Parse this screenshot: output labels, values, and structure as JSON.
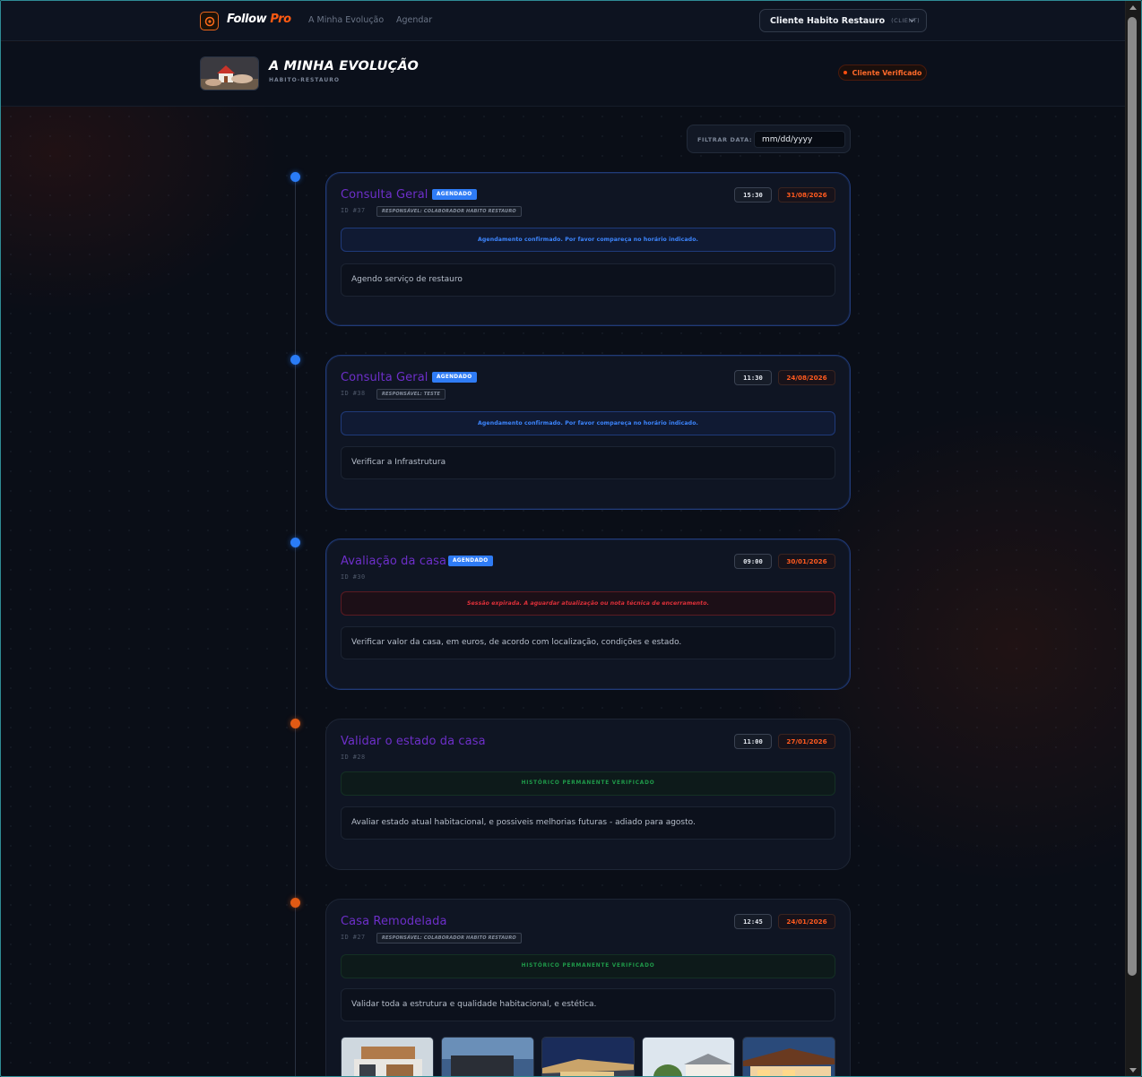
{
  "brand": {
    "name_white": "Follow",
    "name_orange": "Pro"
  },
  "nav": {
    "items": [
      {
        "label": "A Minha Evolução"
      },
      {
        "label": "Agendar"
      }
    ]
  },
  "client": {
    "name": "Cliente Habito Restauro",
    "role": "(CLIENT)"
  },
  "header": {
    "title": "A MINHA EVOLUÇÃO",
    "subtitle": "HABITO-RESTAURO",
    "verified_label": "Cliente Verificado"
  },
  "filter": {
    "label": "FILTRAR DATA:",
    "placeholder": "mm/dd/yyyy"
  },
  "colors": {
    "accent_orange": "#ff5a12",
    "accent_blue": "#2f7cf6",
    "title_purple": "#6d2fc9",
    "status_green": "#1f9a4a",
    "status_red": "#e0303a"
  },
  "entries": [
    {
      "title": "Consulta Geral",
      "badge": "AGENDADO",
      "id": "ID #37",
      "responsible": "RESPONSÁVEL: COLABORADOR HABITO RESTAURO",
      "time": "15:30",
      "date": "31/08/2026",
      "notice": "Agendamento confirmado. Por favor compareça no horário indicado.",
      "description": "Agendo serviço de restauro"
    },
    {
      "title": "Consulta Geral",
      "badge": "AGENDADO",
      "id": "ID #38",
      "responsible": "RESPONSÁVEL: TESTE",
      "time": "11:30",
      "date": "24/08/2026",
      "notice": "Agendamento confirmado. Por favor compareça no horário indicado.",
      "description": "Verificar a Infrastrutura"
    },
    {
      "title": "Avaliação da casa",
      "badge": "AGENDADO",
      "id": "ID #30",
      "time": "09:00",
      "date": "30/01/2026",
      "notice": "Sessão expirada. A aguardar atualização ou nota técnica de encerramento.",
      "description": "Verificar valor da casa, em euros, de acordo com localização, condições e estado."
    },
    {
      "title": "Validar o estado da casa",
      "id": "ID #28",
      "time": "11:00",
      "date": "27/01/2026",
      "notice": "HISTÓRICO PERMANENTE VERIFICADO",
      "description": "Avaliar estado atual habitacional, e possiveis melhorias futuras - adiado para agosto."
    },
    {
      "title": "Casa Remodelada",
      "id": "ID #27",
      "responsible": "RESPONSÁVEL: COLABORADOR HABITO RESTAURO",
      "time": "12:45",
      "date": "24/01/2026",
      "notice": "HISTÓRICO PERMANENTE VERIFICADO",
      "description": "Validar toda a estrutura e qualidade habitacional, e estética."
    }
  ]
}
